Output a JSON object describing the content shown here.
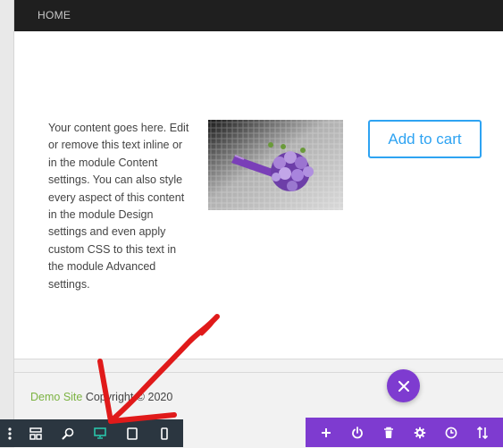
{
  "nav": {
    "home_label": "HOME"
  },
  "content": {
    "text": "Your content goes here. Edit or remove this text inline or in the module Content settings. You can also style every aspect of this content in the module Design settings and even apply custom CSS to this text in the module Advanced settings."
  },
  "product": {
    "image_icon": "flower-bouquet-image",
    "cart_label": "Add to cart"
  },
  "footer": {
    "brand": "Demo Site",
    "copyright": " Copyright © 2020"
  },
  "builder": {
    "close_icon": "close-icon",
    "left_toolbar": [
      "more-icon",
      "layout-icon",
      "zoom-icon",
      "desktop-icon",
      "tablet-icon",
      "phone-icon"
    ],
    "right_toolbar": [
      "add-icon",
      "power-icon",
      "trash-icon",
      "gear-icon",
      "history-icon",
      "sort-icon"
    ]
  },
  "colors": {
    "accent_blue": "#2ea3f2",
    "builder_purple": "#7e3bd0",
    "toolbar_dark": "#2b3640",
    "active_view": "#29c4a9",
    "annotation_red": "#e01a1a",
    "brand_green": "#7cb342"
  }
}
